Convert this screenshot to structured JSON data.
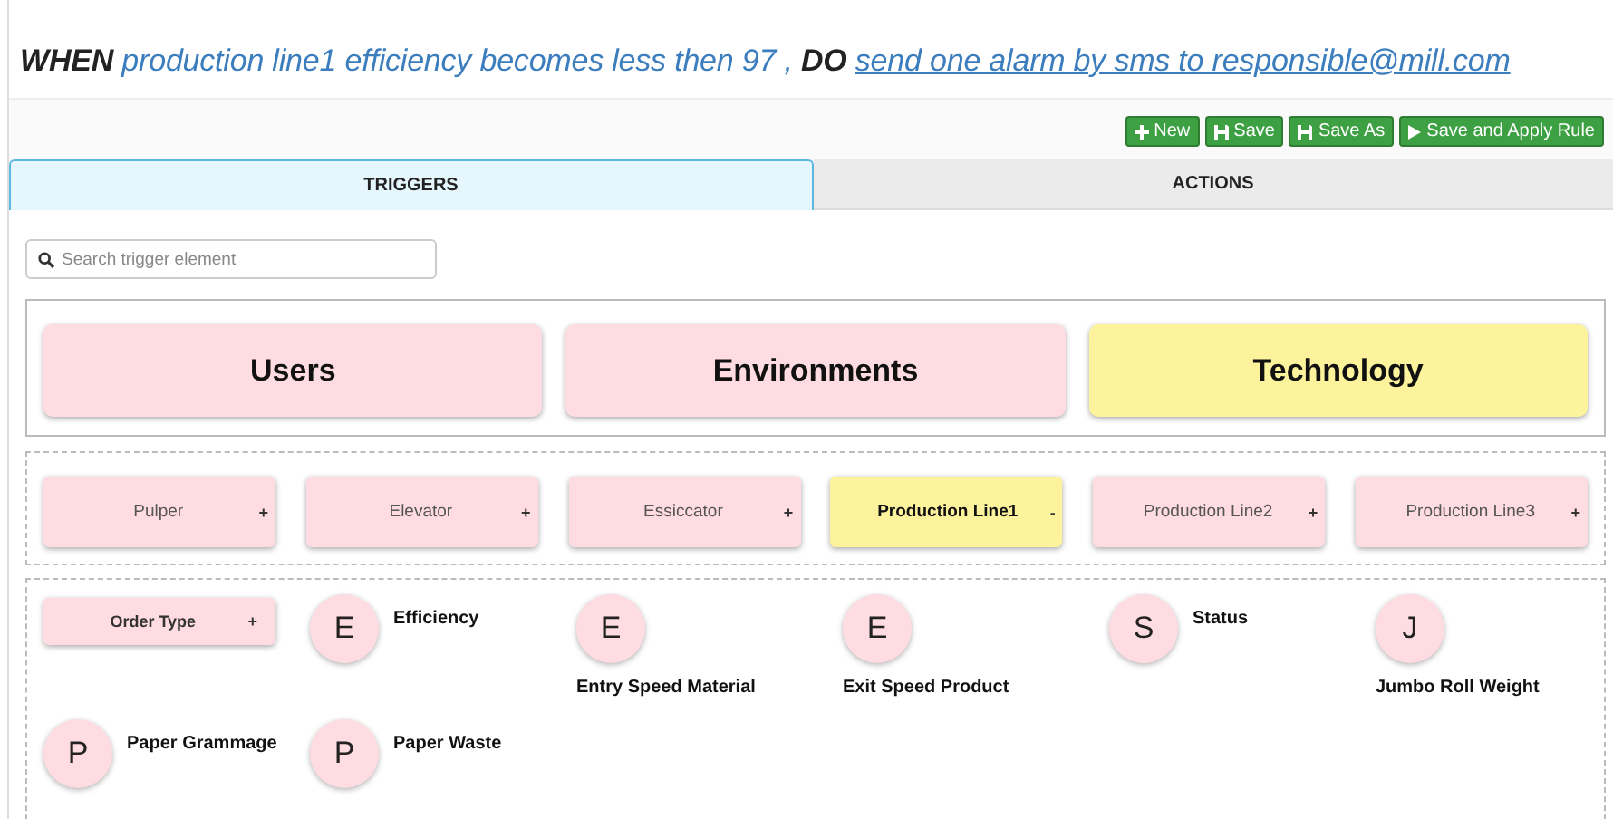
{
  "rule": {
    "when_keyword": "WHEN",
    "condition": "production line1 efficiency becomes less then 97",
    "separator": ",",
    "do_keyword": "DO",
    "action": "send one alarm by sms to responsible@mill.com"
  },
  "toolbar": [
    {
      "label": "New",
      "kind": "new"
    },
    {
      "label": "Save",
      "kind": "save"
    },
    {
      "label": "Save As",
      "kind": "saveas"
    },
    {
      "label": "Save and Apply Rule",
      "kind": "apply"
    }
  ],
  "tabs": [
    {
      "label": "TRIGGERS",
      "selected": true
    },
    {
      "label": "ACTIONS",
      "selected": false
    }
  ],
  "search": {
    "placeholder": "Search trigger element"
  },
  "categories": [
    {
      "label": "Users",
      "selected": false
    },
    {
      "label": "Environments",
      "selected": false
    },
    {
      "label": "Technology",
      "selected": true
    }
  ],
  "lines": [
    {
      "label": "Pulper",
      "toggle": "+",
      "selected": false
    },
    {
      "label": "Elevator",
      "toggle": "+",
      "selected": false
    },
    {
      "label": "Essiccator",
      "toggle": "+",
      "selected": false
    },
    {
      "label": "Production Line1",
      "toggle": "-",
      "selected": true
    },
    {
      "label": "Production Line2",
      "toggle": "+",
      "selected": false
    },
    {
      "label": "Production Line3",
      "toggle": "+",
      "selected": false
    }
  ],
  "elements": [
    {
      "kind": "group",
      "label": "Order Type",
      "toggle": "+"
    },
    {
      "kind": "side",
      "letter": "E",
      "label": "Efficiency"
    },
    {
      "kind": "below",
      "letter": "E",
      "label": "Entry Speed Material"
    },
    {
      "kind": "below",
      "letter": "E",
      "label": "Exit Speed Product"
    },
    {
      "kind": "side",
      "letter": "S",
      "label": "Status"
    },
    {
      "kind": "below",
      "letter": "J",
      "label": "Jumbo Roll Weight"
    },
    {
      "kind": "side",
      "letter": "P",
      "label": "Paper Grammage"
    },
    {
      "kind": "side",
      "letter": "P",
      "label": "Paper Waste"
    }
  ]
}
